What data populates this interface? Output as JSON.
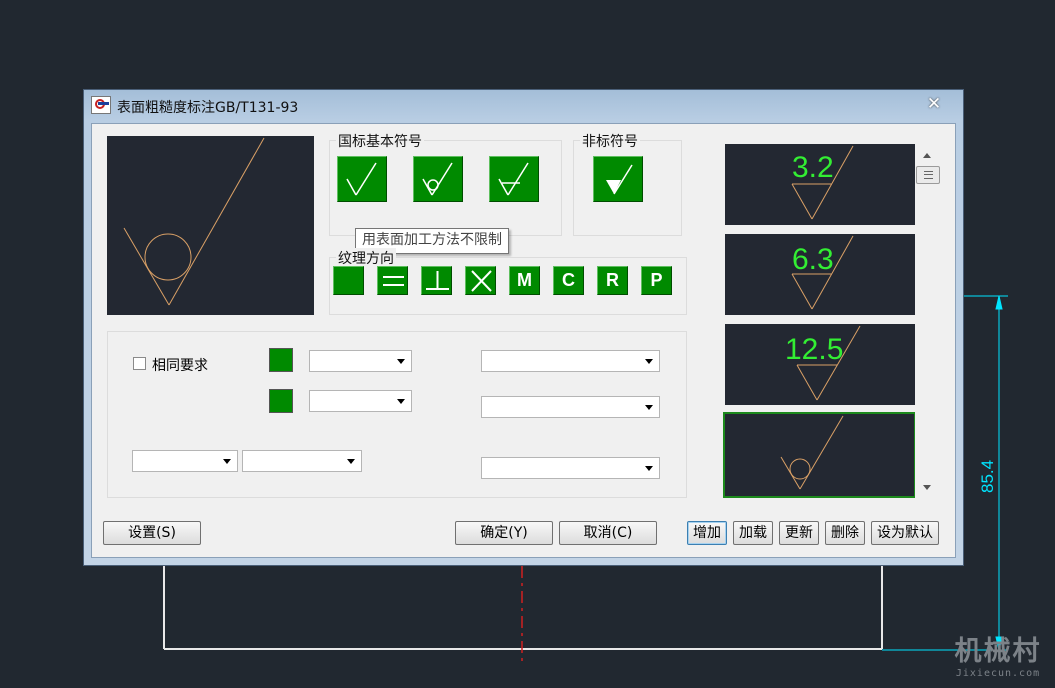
{
  "window": {
    "title": "表面粗糙度标注GB/T131-93"
  },
  "groups": {
    "gb_basic_symbols": "国标基本符号",
    "non_standard_symbols": "非标符号",
    "texture_direction": "纹理方向"
  },
  "tooltip": "用表面加工方法不限制",
  "texture_buttons": [
    "M",
    "C",
    "R",
    "P"
  ],
  "same_requirement_label": "相同要求",
  "buttons": {
    "settings": "设置(S)",
    "ok": "确定(Y)",
    "cancel": "取消(C)",
    "add": "增加",
    "load": "加载",
    "update": "更新",
    "delete": "删除",
    "set_default": "设为默认"
  },
  "history": [
    "3.2",
    "6.3",
    "12.5"
  ],
  "dimension_text": "85.4",
  "watermark": {
    "main": "机械村",
    "sub": "Jixiecun.com"
  },
  "colors": {
    "accent_green": "#008a00",
    "cad_background": "#212830",
    "dimension_cyan": "#00e5ff",
    "roughness_text": "#33ee33",
    "symbol_orange": "#d9a066"
  }
}
